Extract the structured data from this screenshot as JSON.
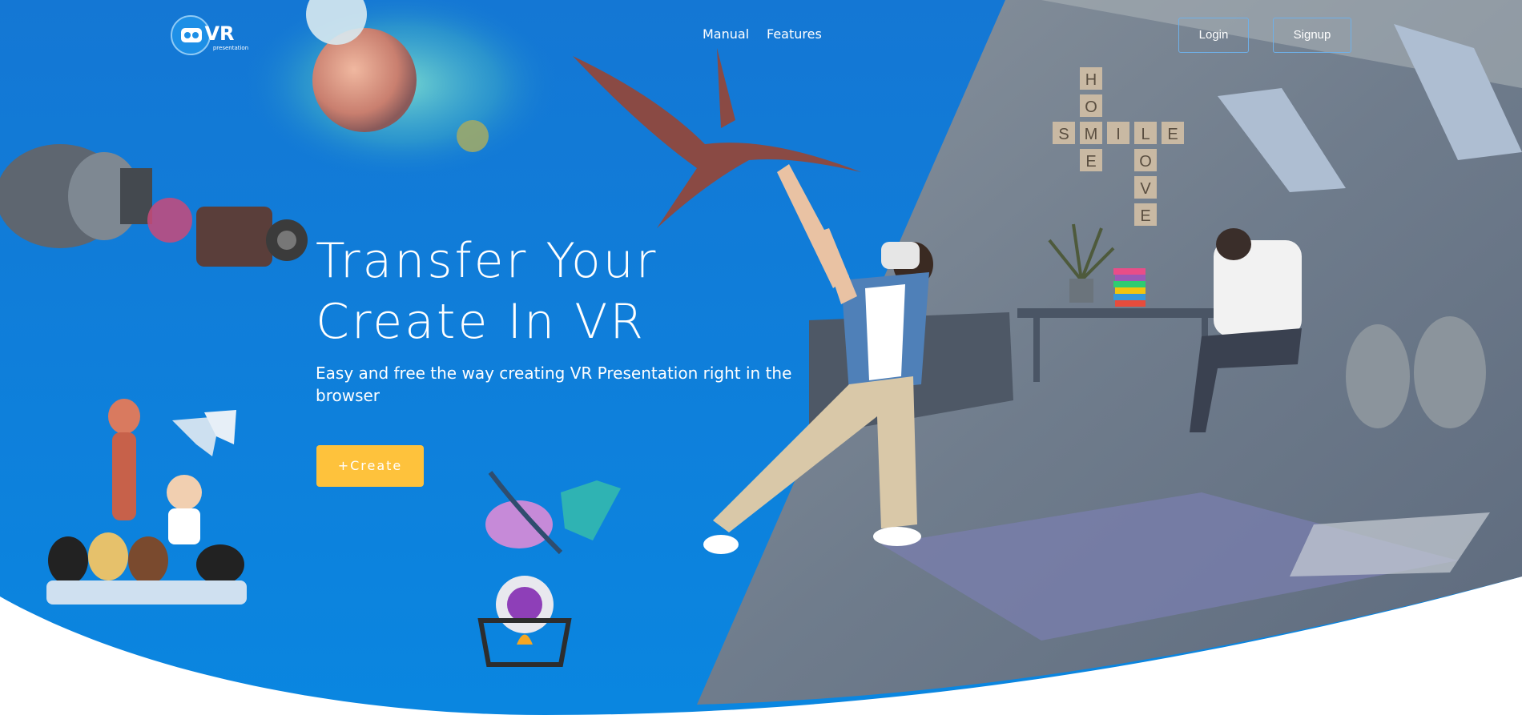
{
  "header": {
    "logo_text": "VR",
    "logo_subtext": "presentation",
    "nav": [
      {
        "label": "Manual"
      },
      {
        "label": "Features"
      }
    ],
    "login_label": "Login",
    "signup_label": "Signup"
  },
  "hero": {
    "title_line1": "Transfer Your",
    "title_line2": "Create In VR",
    "subtitle": "Easy and free the way creating VR Presentation right in the browser",
    "cta_label": "+Create"
  },
  "room_tiles": {
    "vertical_1": [
      "H",
      "O",
      "M",
      "E"
    ],
    "horizontal": [
      "S",
      "M",
      "I",
      "L",
      "E"
    ],
    "vertical_2": [
      "L",
      "O",
      "V",
      "E"
    ]
  },
  "colors": {
    "hero_blue": "#0f7ed8",
    "cta_yellow": "#fec23c",
    "room_gray": "#6b7a8c",
    "white": "#ffffff"
  }
}
